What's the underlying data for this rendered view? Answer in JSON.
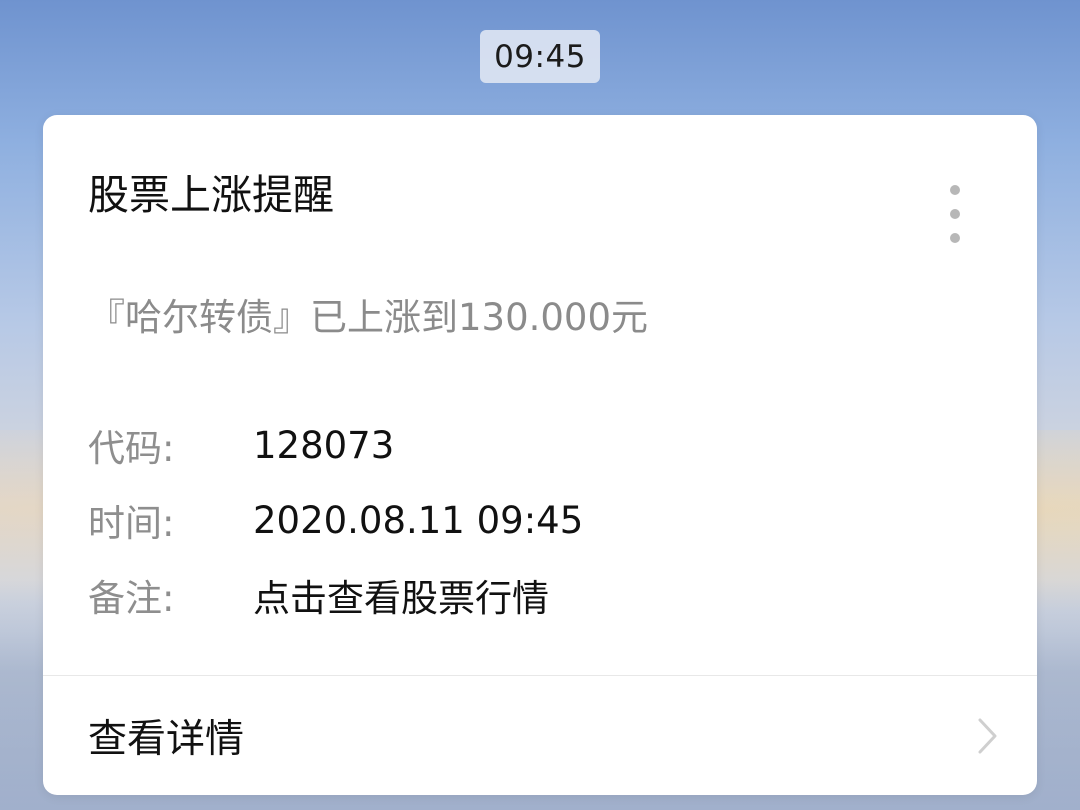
{
  "status_time": "09:45",
  "card": {
    "title": "股票上涨提醒",
    "summary": "『哈尔转债』已上涨到130.000元",
    "fields": [
      {
        "label": "代码:",
        "value": "128073"
      },
      {
        "label": "时间:",
        "value": "2020.08.11 09:45"
      },
      {
        "label": "备注:",
        "value": "点击查看股票行情"
      }
    ],
    "detail_label": "查看详情",
    "more_icon": "more-vertical-icon",
    "chevron_icon": "chevron-right-icon"
  },
  "colors": {
    "card_bg": "#ffffff",
    "muted_text": "#8b8b8b",
    "primary_text": "#111111"
  }
}
